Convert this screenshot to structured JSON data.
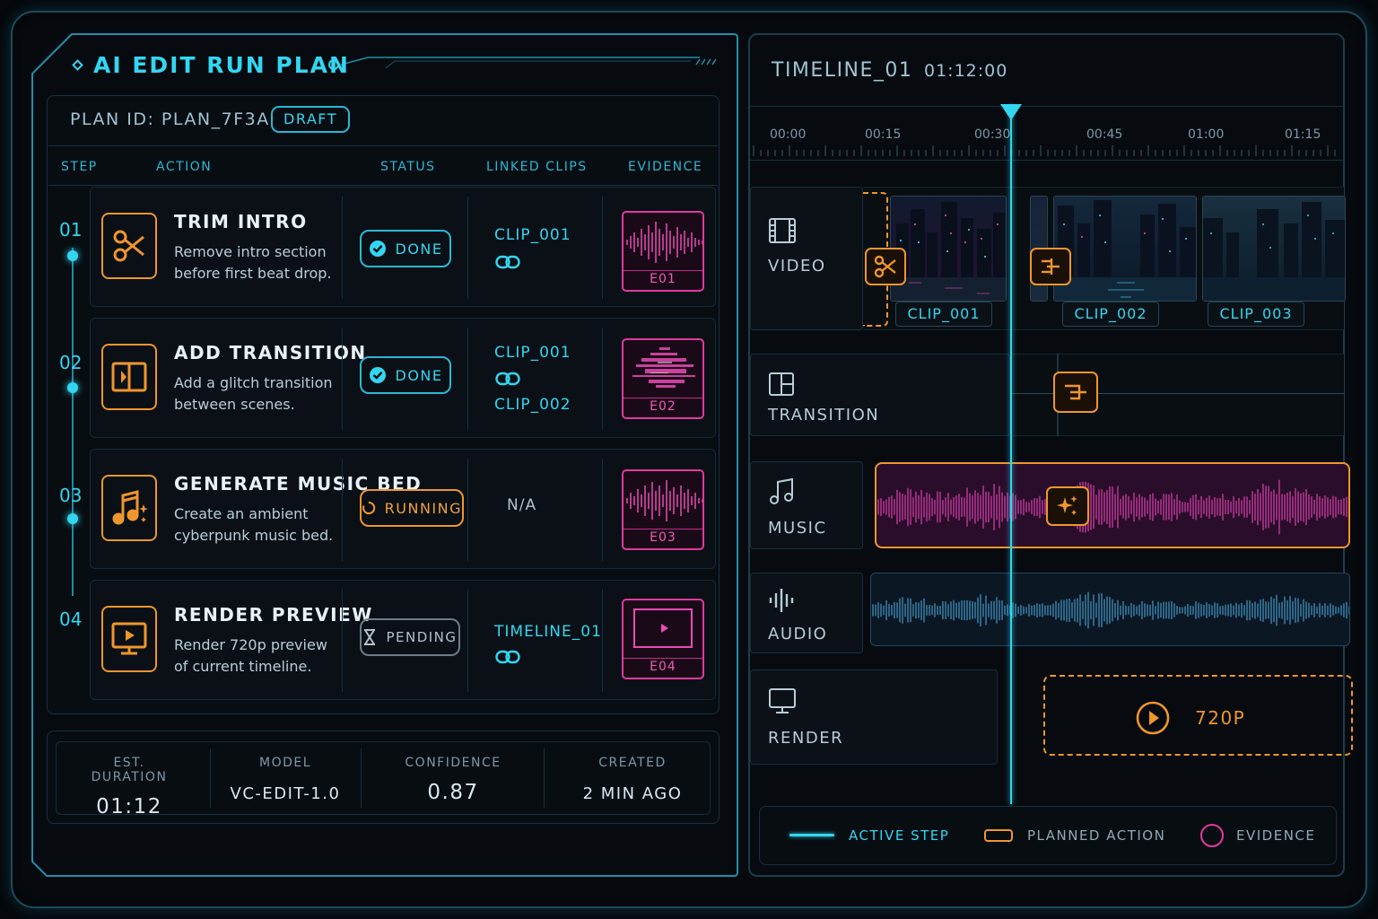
{
  "plan": {
    "title": "AI EDIT RUN PLAN",
    "plan_id_label": "PLAN ID:",
    "plan_id": "PLAN_7F3A",
    "status_badge": "DRAFT",
    "columns": [
      "STEP",
      "ACTION",
      "STATUS",
      "LINKED CLIPS",
      "EVIDENCE"
    ],
    "steps": [
      {
        "num": "01",
        "title": "TRIM INTRO",
        "desc": "Remove intro section before first beat drop.",
        "status": "DONE",
        "clips": [
          "CLIP_001"
        ],
        "evidence": "E01",
        "icon": "scissors-icon"
      },
      {
        "num": "02",
        "title": "ADD TRANSITION",
        "desc": "Add a glitch transition between scenes.",
        "status": "DONE",
        "clips": [
          "CLIP_001",
          "CLIP_002"
        ],
        "evidence": "E02",
        "icon": "transition-icon"
      },
      {
        "num": "03",
        "title": "GENERATE MUSIC BED",
        "desc": "Create an ambient cyberpunk music bed.",
        "status": "RUNNING",
        "clips_text": "N/A",
        "evidence": "E03",
        "icon": "music-sparkle-icon"
      },
      {
        "num": "04",
        "title": "RENDER PREVIEW",
        "desc": "Render 720p preview of current timeline.",
        "status": "PENDING",
        "clips": [
          "TIMELINE_01"
        ],
        "evidence": "E04",
        "icon": "monitor-play-icon"
      }
    ],
    "stats": [
      {
        "label": "EST. DURATION",
        "value": "01:12"
      },
      {
        "label": "MODEL",
        "value": "VC-EDIT-1.0"
      },
      {
        "label": "CONFIDENCE",
        "value": "0.87"
      },
      {
        "label": "CREATED",
        "value": "2 MIN AGO"
      }
    ]
  },
  "timeline": {
    "name": "TIMELINE_01",
    "duration": "01:12:00",
    "ticks": [
      "00:00",
      "00:15",
      "00:30",
      "00:45",
      "01:00",
      "01:15"
    ],
    "tracks": [
      "VIDEO",
      "TRANSITION",
      "MUSIC",
      "AUDIO",
      "RENDER"
    ],
    "clips": [
      "CLIP_001",
      "CLIP_002",
      "CLIP_003"
    ],
    "render_label": "720P"
  },
  "legend": {
    "active": "ACTIVE STEP",
    "planned": "PLANNED ACTION",
    "evidence": "EVIDENCE"
  },
  "colors": {
    "cyan": "#33d6f0",
    "orange": "#f0962c",
    "magenta": "#e0399f"
  }
}
